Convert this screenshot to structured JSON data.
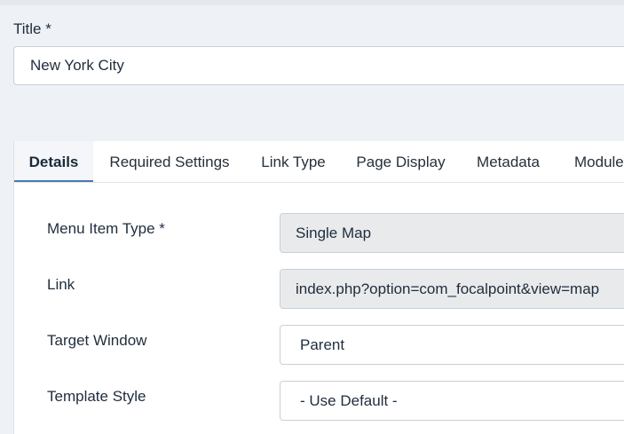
{
  "title_field": {
    "label": "Title *",
    "value": "New York City"
  },
  "tabs": [
    {
      "label": "Details",
      "active": true
    },
    {
      "label": "Required Settings",
      "active": false
    },
    {
      "label": "Link Type",
      "active": false
    },
    {
      "label": "Page Display",
      "active": false
    },
    {
      "label": "Metadata",
      "active": false
    },
    {
      "label": "Module",
      "active": false
    }
  ],
  "details": {
    "menu_item_type": {
      "label": "Menu Item Type *",
      "value": "Single Map"
    },
    "link": {
      "label": "Link",
      "value": "index.php?option=com_focalpoint&view=map"
    },
    "target_window": {
      "label": "Target Window",
      "value": "Parent"
    },
    "template_style": {
      "label": "Template Style",
      "value": "- Use Default -"
    }
  },
  "colors": {
    "page_background": "#eef2f7",
    "active_tab_underline": "#4a7bb0",
    "readonly_field_background": "#e9eaeb"
  }
}
